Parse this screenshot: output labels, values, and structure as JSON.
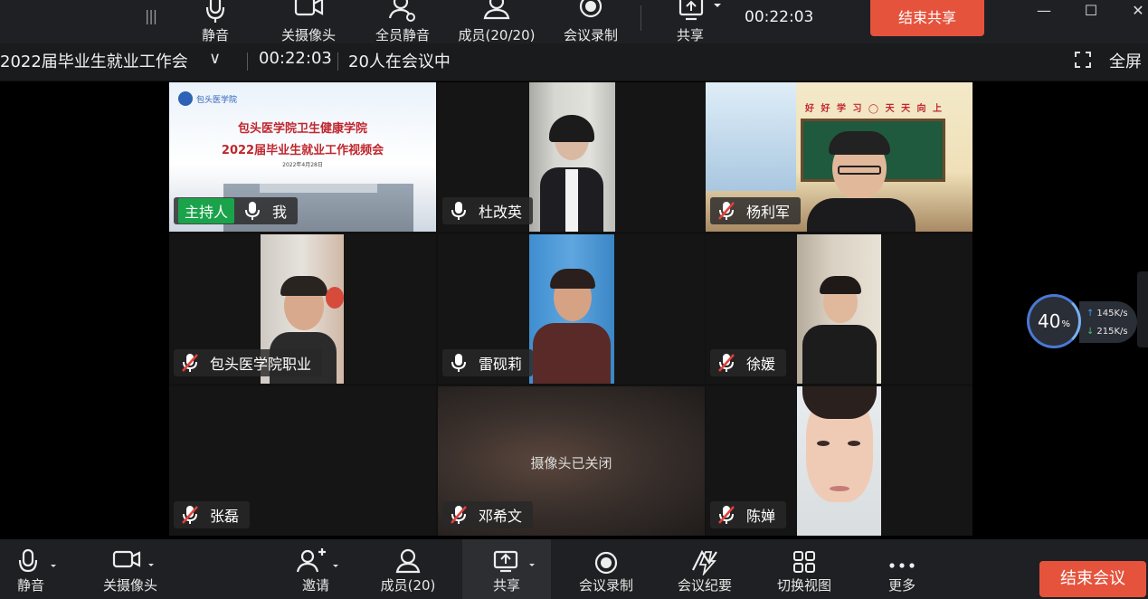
{
  "share_toolbar": {
    "grip": "|||",
    "buttons": [
      {
        "label": "静音",
        "icon": "microphone-icon"
      },
      {
        "label": "关摄像头",
        "icon": "camera-icon"
      },
      {
        "label": "全员静音",
        "icon": "mute-all-icon"
      },
      {
        "label": "成员(20/20)",
        "icon": "members-icon"
      },
      {
        "label": "会议录制",
        "icon": "record-icon"
      },
      {
        "label": "共享",
        "icon": "share-screen-icon"
      }
    ],
    "timer": "00:22:03",
    "end_share_label": "结束共享"
  },
  "info_bar": {
    "title": "2022届毕业生就业工作会",
    "chevron": "∨",
    "elapsed": "00:22:03",
    "participants_text": "20人在会议中",
    "fullscreen_label": "全屏"
  },
  "slide": {
    "logo_text": "包头医学院",
    "line1": "包头医学院卫生健康学院",
    "line2": "2022届毕业生就业工作视频会",
    "date": "2022年4月28日"
  },
  "tiles": [
    {
      "name": "我",
      "host_badge": "主持人",
      "mic": "on"
    },
    {
      "name": "杜改英",
      "mic": "on"
    },
    {
      "name": "杨利军",
      "mic": "muted"
    },
    {
      "name": "包头医学院职业",
      "mic": "muted"
    },
    {
      "name": "雷砚莉",
      "mic": "on"
    },
    {
      "name": "徐媛",
      "mic": "muted"
    },
    {
      "name": "张磊",
      "mic": "muted"
    },
    {
      "name": "邓希文",
      "mic": "muted",
      "status": "摄像头已关闭"
    },
    {
      "name": "陈婵",
      "mic": "muted"
    }
  ],
  "classroom_banner": "好 好 学 习 ◯ 天 天 向 上",
  "network": {
    "percent": "40",
    "percent_unit": "%",
    "upload": "145",
    "download": "215",
    "rate_unit": "K/s"
  },
  "bottom_toolbar": {
    "buttons": [
      {
        "label": "静音",
        "icon": "microphone-icon"
      },
      {
        "label": "关摄像头",
        "icon": "camera-icon"
      },
      {
        "label": "邀请",
        "icon": "invite-icon"
      },
      {
        "label": "成员(20)",
        "icon": "members-icon"
      },
      {
        "label": "共享",
        "icon": "share-screen-icon"
      },
      {
        "label": "会议录制",
        "icon": "record-icon"
      },
      {
        "label": "会议纪要",
        "icon": "minutes-icon"
      },
      {
        "label": "切换视图",
        "icon": "grid-view-icon"
      },
      {
        "label": "更多",
        "icon": "more-icon"
      }
    ],
    "end_meeting_label": "结束会议"
  },
  "colors": {
    "accent_red": "#e5533d",
    "host_green": "#1aa34a",
    "toolbar_bg": "#1f2023",
    "muted_red": "#e0413a"
  }
}
